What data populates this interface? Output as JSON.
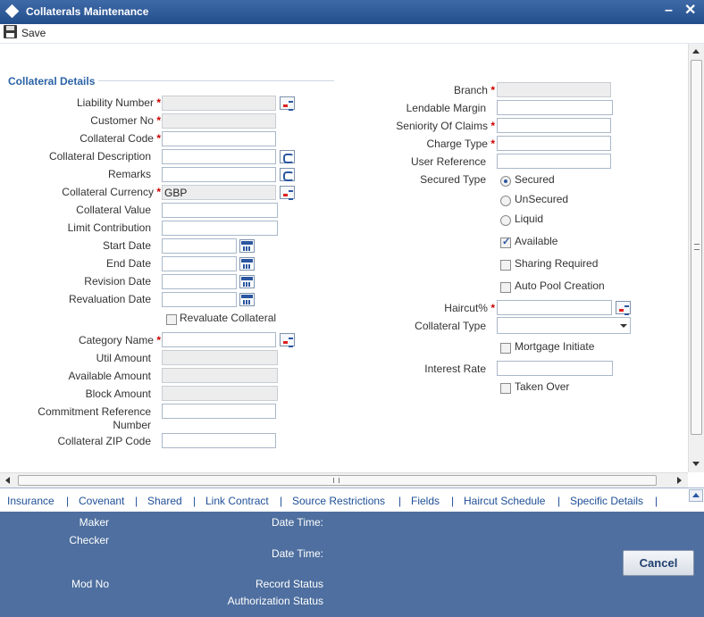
{
  "window": {
    "title": "Collaterals Maintenance",
    "minimize_label": "–",
    "close_label": "✕"
  },
  "toolbar": {
    "save_label": "Save"
  },
  "section": {
    "title": "Collateral Details"
  },
  "left": {
    "liability_number": "Liability Number",
    "customer_no": "Customer No",
    "collateral_code": "Collateral Code",
    "collateral_description": "Collateral Description",
    "remarks": "Remarks",
    "collateral_currency": "Collateral Currency",
    "collateral_currency_value": "GBP",
    "collateral_value": "Collateral Value",
    "limit_contribution": "Limit Contribution",
    "start_date": "Start Date",
    "end_date": "End Date",
    "revision_date": "Revision Date",
    "revaluation_date": "Revaluation Date",
    "revaluate_collateral": "Revaluate Collateral",
    "category_name": "Category Name",
    "util_amount": "Util Amount",
    "available_amount": "Available Amount",
    "block_amount": "Block Amount",
    "commitment_reference_line1": "Commitment Reference",
    "commitment_reference_line2": "Number",
    "collateral_zip_code": "Collateral ZIP Code"
  },
  "right": {
    "branch": "Branch",
    "lendable_margin": "Lendable Margin",
    "seniority_of_claims": "Seniority Of Claims",
    "charge_type": "Charge Type",
    "user_reference": "User Reference",
    "secured_type": "Secured Type",
    "secured_options": [
      "Secured",
      "UnSecured",
      "Liquid"
    ],
    "secured_selected": "Secured",
    "available": "Available",
    "available_checked": true,
    "sharing_required": "Sharing Required",
    "auto_pool_creation": "Auto Pool Creation",
    "haircut": "Haircut%",
    "collateral_type": "Collateral Type",
    "mortgage_initiate": "Mortgage Initiate",
    "interest_rate": "Interest Rate",
    "taken_over": "Taken Over"
  },
  "required_marker": "*",
  "tabs": [
    "Insurance",
    "Covenant",
    "Shared",
    "Link Contract",
    "Source Restrictions",
    "Fields",
    "Haircut Schedule",
    "Specific Details"
  ],
  "tab_separator": "|",
  "footer": {
    "maker": "Maker",
    "checker": "Checker",
    "date_time_1": "Date Time:",
    "date_time_2": "Date Time:",
    "mod_no": "Mod No",
    "record_status": "Record Status",
    "authorization_status": "Authorization Status",
    "cancel_label": "Cancel"
  },
  "colors": {
    "title_bar": "#2f5d9c",
    "footer": "#4e6f9f",
    "link": "#1f4f96",
    "required": "#cc0000"
  }
}
